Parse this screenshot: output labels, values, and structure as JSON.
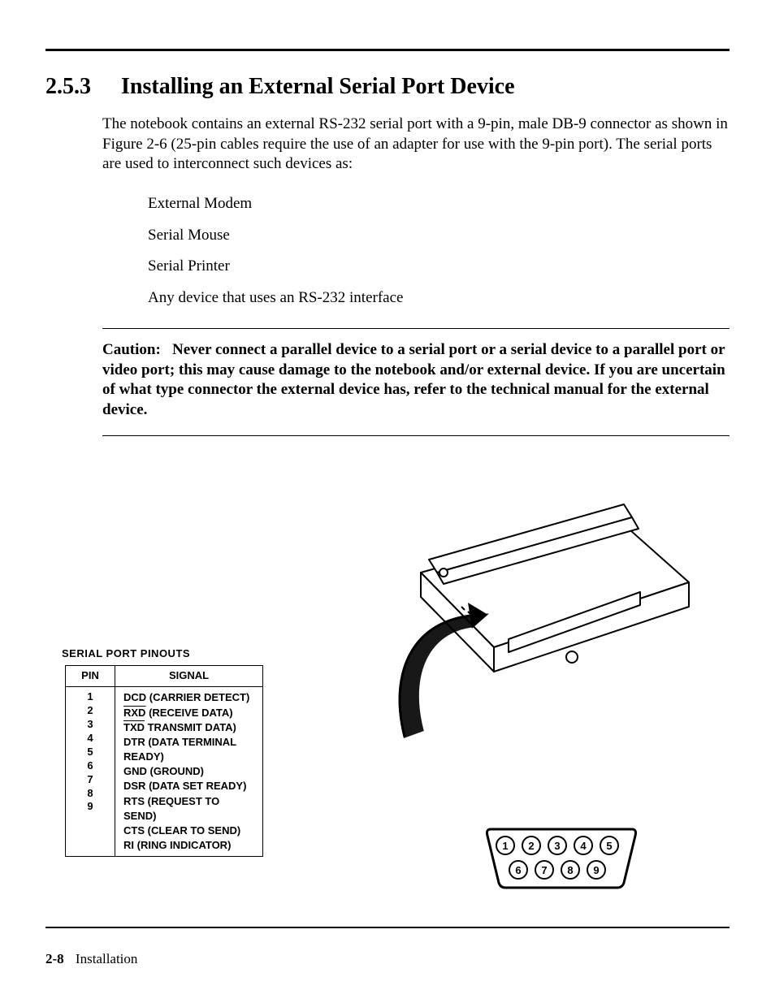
{
  "section_number": "2.5.3",
  "section_title": "Installing an External Serial Port Device",
  "intro_paragraph": "The notebook contains an external RS-232 serial port with a 9-pin, male DB-9 connector as shown in Figure 2-6 (25-pin cables require the use of an adapter for use with the 9-pin port). The serial ports are used to interconnect such devices as:",
  "bullets": [
    "External Modem",
    "Serial Mouse",
    "Serial Printer",
    "Any device that uses an RS-232 interface"
  ],
  "caution_label": "Caution:",
  "caution_text": "Never connect a parallel device to a serial port or a serial device to a parallel port or video port; this may cause damage to the notebook and/or external device. If you are uncertain of what type connector the external device has, refer to the technical manual for the external device.",
  "pinout_title": "SERIAL PORT PINOUTS",
  "pinout_headers": {
    "pin": "PIN",
    "signal": "SIGNAL"
  },
  "pinouts": [
    {
      "pin": "1",
      "abbr": "DCD",
      "desc": "(CARRIER DETECT)",
      "over": false
    },
    {
      "pin": "2",
      "abbr": "RXD",
      "desc": "(RECEIVE DATA)",
      "over": true
    },
    {
      "pin": "3",
      "abbr": "TXD",
      "desc": "TRANSMIT DATA)",
      "over": true
    },
    {
      "pin": "4",
      "abbr": "DTR",
      "desc": "(DATA TERMINAL READY)",
      "over": false
    },
    {
      "pin": "5",
      "abbr": "GND",
      "desc": "(GROUND)",
      "over": false
    },
    {
      "pin": "6",
      "abbr": "DSR",
      "desc": "(DATA SET READY)",
      "over": false
    },
    {
      "pin": "7",
      "abbr": "RTS",
      "desc": "(REQUEST TO SEND)",
      "over": false
    },
    {
      "pin": "8",
      "abbr": "CTS",
      "desc": "(CLEAR TO SEND)",
      "over": false
    },
    {
      "pin": "9",
      "abbr": "RI",
      "desc": "(RING INDICATOR)",
      "over": false
    }
  ],
  "db9_pins": [
    "1",
    "2",
    "3",
    "4",
    "5",
    "6",
    "7",
    "8",
    "9"
  ],
  "footer": {
    "page": "2-8",
    "label": "Installation"
  }
}
